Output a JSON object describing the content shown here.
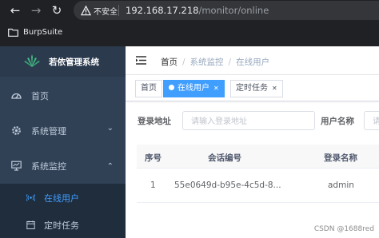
{
  "browser": {
    "security_label": "不安全",
    "url_host": "192.168.17.218",
    "url_path": "/monitor/online",
    "bookmark": "BurpSuite"
  },
  "sidebar": {
    "title": "若依管理系统",
    "items": [
      {
        "label": "首页",
        "icon": "dashboard-icon"
      },
      {
        "label": "系统管理",
        "icon": "gear-icon"
      },
      {
        "label": "系统监控",
        "icon": "monitor-icon"
      }
    ],
    "sub_items": [
      {
        "label": "在线用户",
        "icon": "online-icon"
      },
      {
        "label": "定时任务",
        "icon": "job-icon"
      }
    ]
  },
  "breadcrumb": [
    "首页",
    "系统监控",
    "在线用户"
  ],
  "tags": [
    {
      "label": "首页"
    },
    {
      "label": "在线用户"
    },
    {
      "label": "定时任务"
    }
  ],
  "search": {
    "login_address_label": "登录地址",
    "login_address_placeholder": "请输入登录地址",
    "username_label": "用户名称",
    "username_placeholder": "请"
  },
  "table": {
    "headers": [
      "序号",
      "会话编号",
      "登录名称"
    ],
    "rows": [
      {
        "index": "1",
        "session_id": "55e0649d-b95e-4c5d-8...",
        "login_name": "admin"
      }
    ]
  },
  "watermark": "CSDN @1688red",
  "colors": {
    "accent": "#409eff",
    "sidebar": "#304156",
    "chrome": "#202124"
  }
}
